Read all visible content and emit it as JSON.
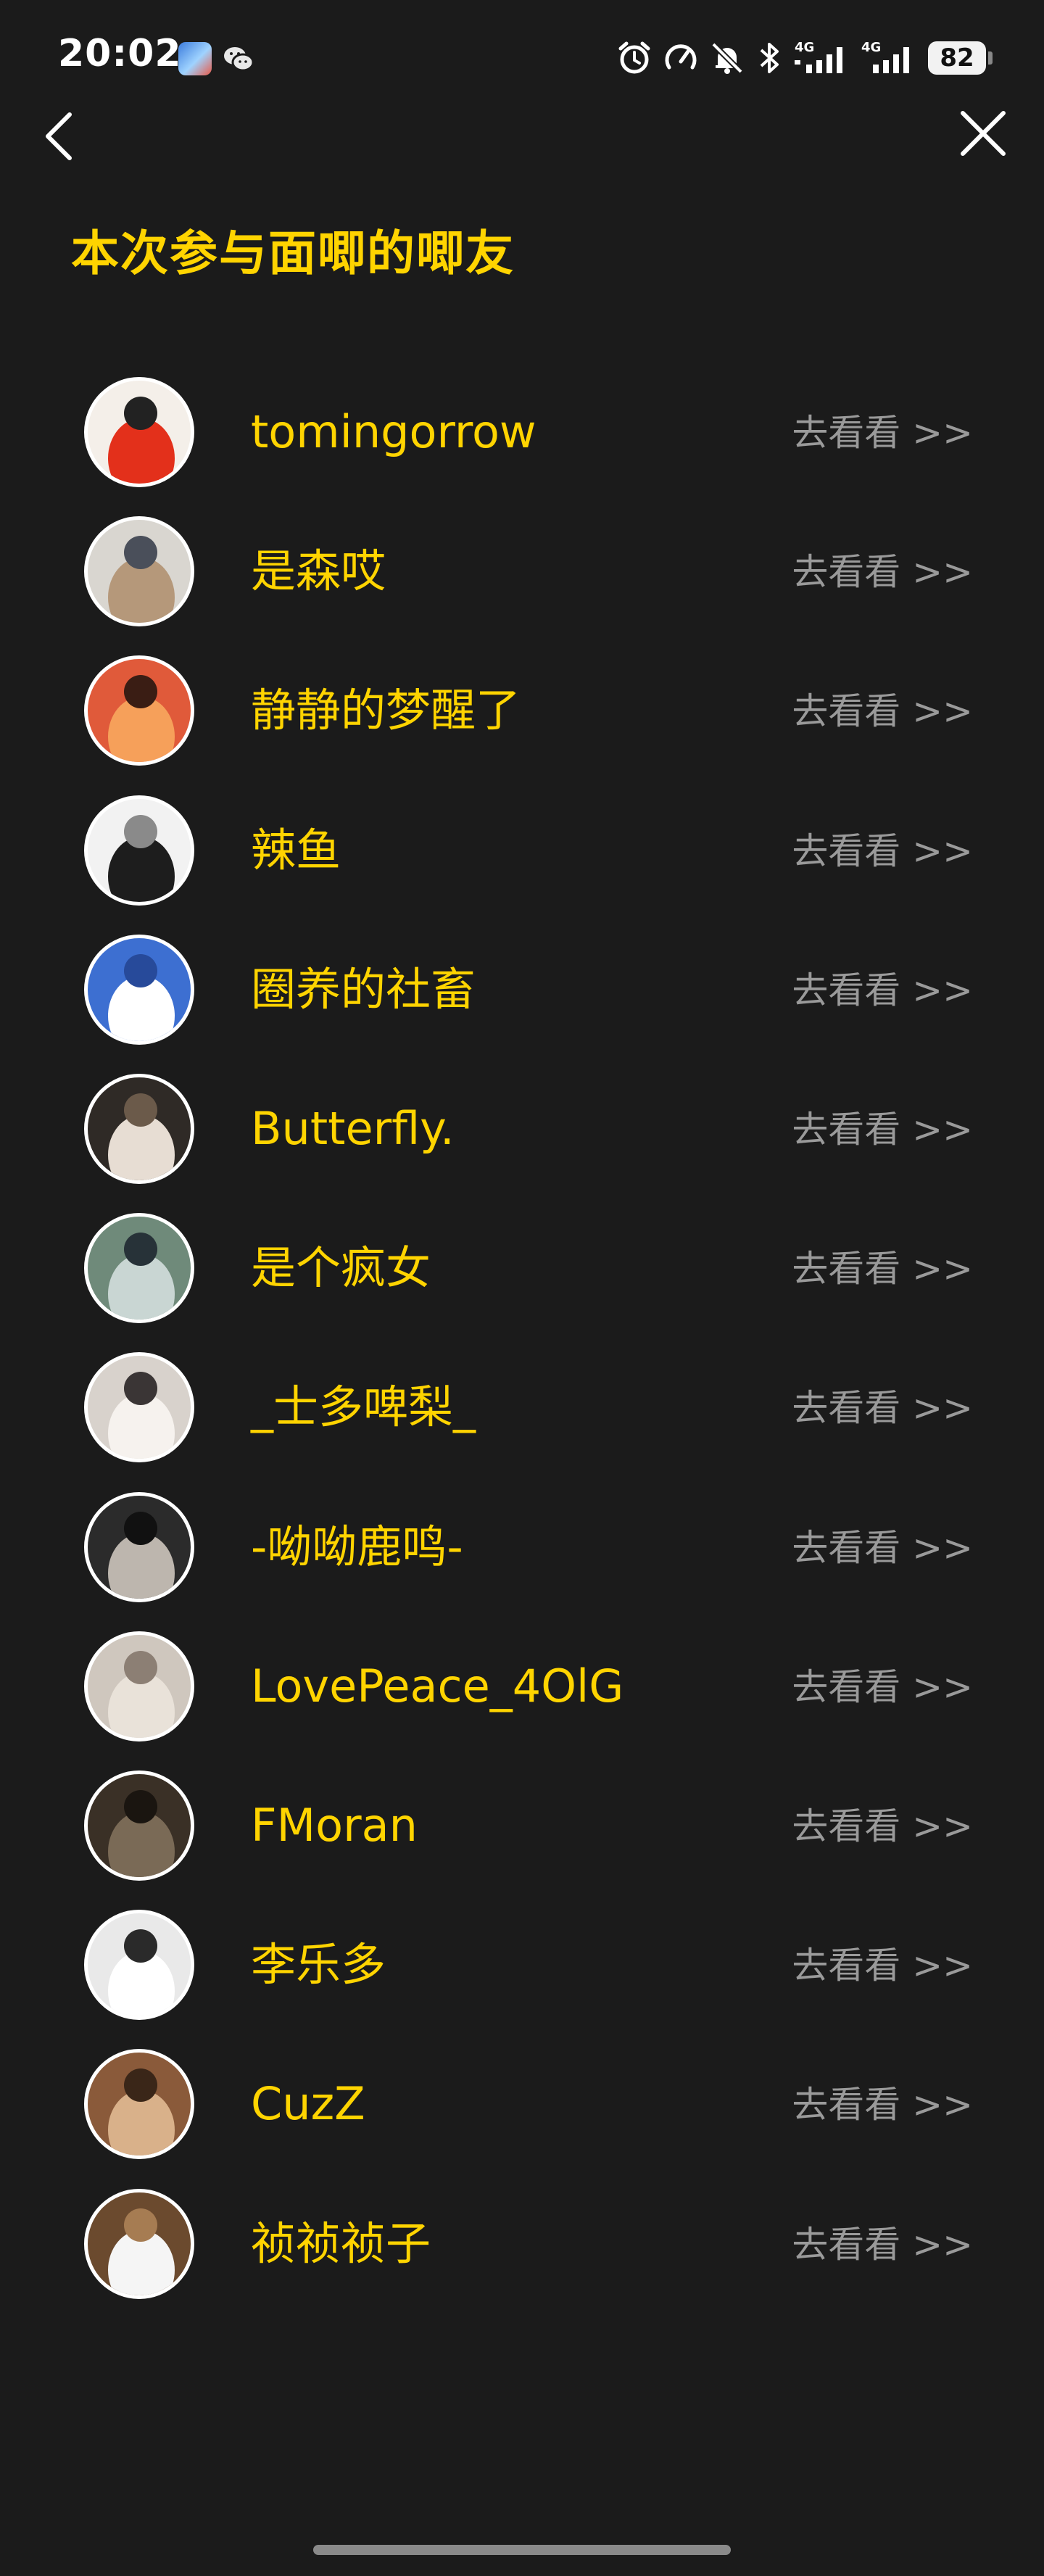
{
  "status_bar": {
    "time": "20:02",
    "network_1": "4G",
    "network_2": "4G",
    "battery": "82",
    "icons": [
      "game-app-icon",
      "wechat-icon",
      "alarm-icon",
      "speed-icon",
      "mute-bell-icon",
      "bluetooth-icon",
      "signal-icon",
      "signal-icon",
      "battery-icon"
    ]
  },
  "nav": {
    "back_icon": "chevron-left-icon",
    "close_icon": "close-icon"
  },
  "page_title": "本次参与面唧的唧友",
  "colors": {
    "background": "#1b1b1b",
    "accent": "#ffd400",
    "link": "#9a9a9a"
  },
  "friends": [
    {
      "name": "tomingorrow",
      "link": "去看看 >>"
    },
    {
      "name": "是森哎",
      "link": "去看看 >>"
    },
    {
      "name": "静静的梦醒了",
      "link": "去看看 >>"
    },
    {
      "name": "辣鱼",
      "link": "去看看 >>"
    },
    {
      "name": "圈养的社畜",
      "link": "去看看 >>"
    },
    {
      "name": "Butterfly.",
      "link": "去看看 >>"
    },
    {
      "name": "是个疯女",
      "link": "去看看 >>"
    },
    {
      "name": "_士多啤梨_",
      "link": "去看看 >>"
    },
    {
      "name": "-呦呦鹿鸣-",
      "link": "去看看 >>"
    },
    {
      "name": "LovePeace_4OlG",
      "link": "去看看 >>"
    },
    {
      "name": "FMoran",
      "link": "去看看 >>"
    },
    {
      "name": "李乐多",
      "link": "去看看 >>"
    },
    {
      "name": "CuzZ",
      "link": "去看看 >>"
    },
    {
      "name": "祯祯祯子",
      "link": "去看看 >>"
    }
  ]
}
